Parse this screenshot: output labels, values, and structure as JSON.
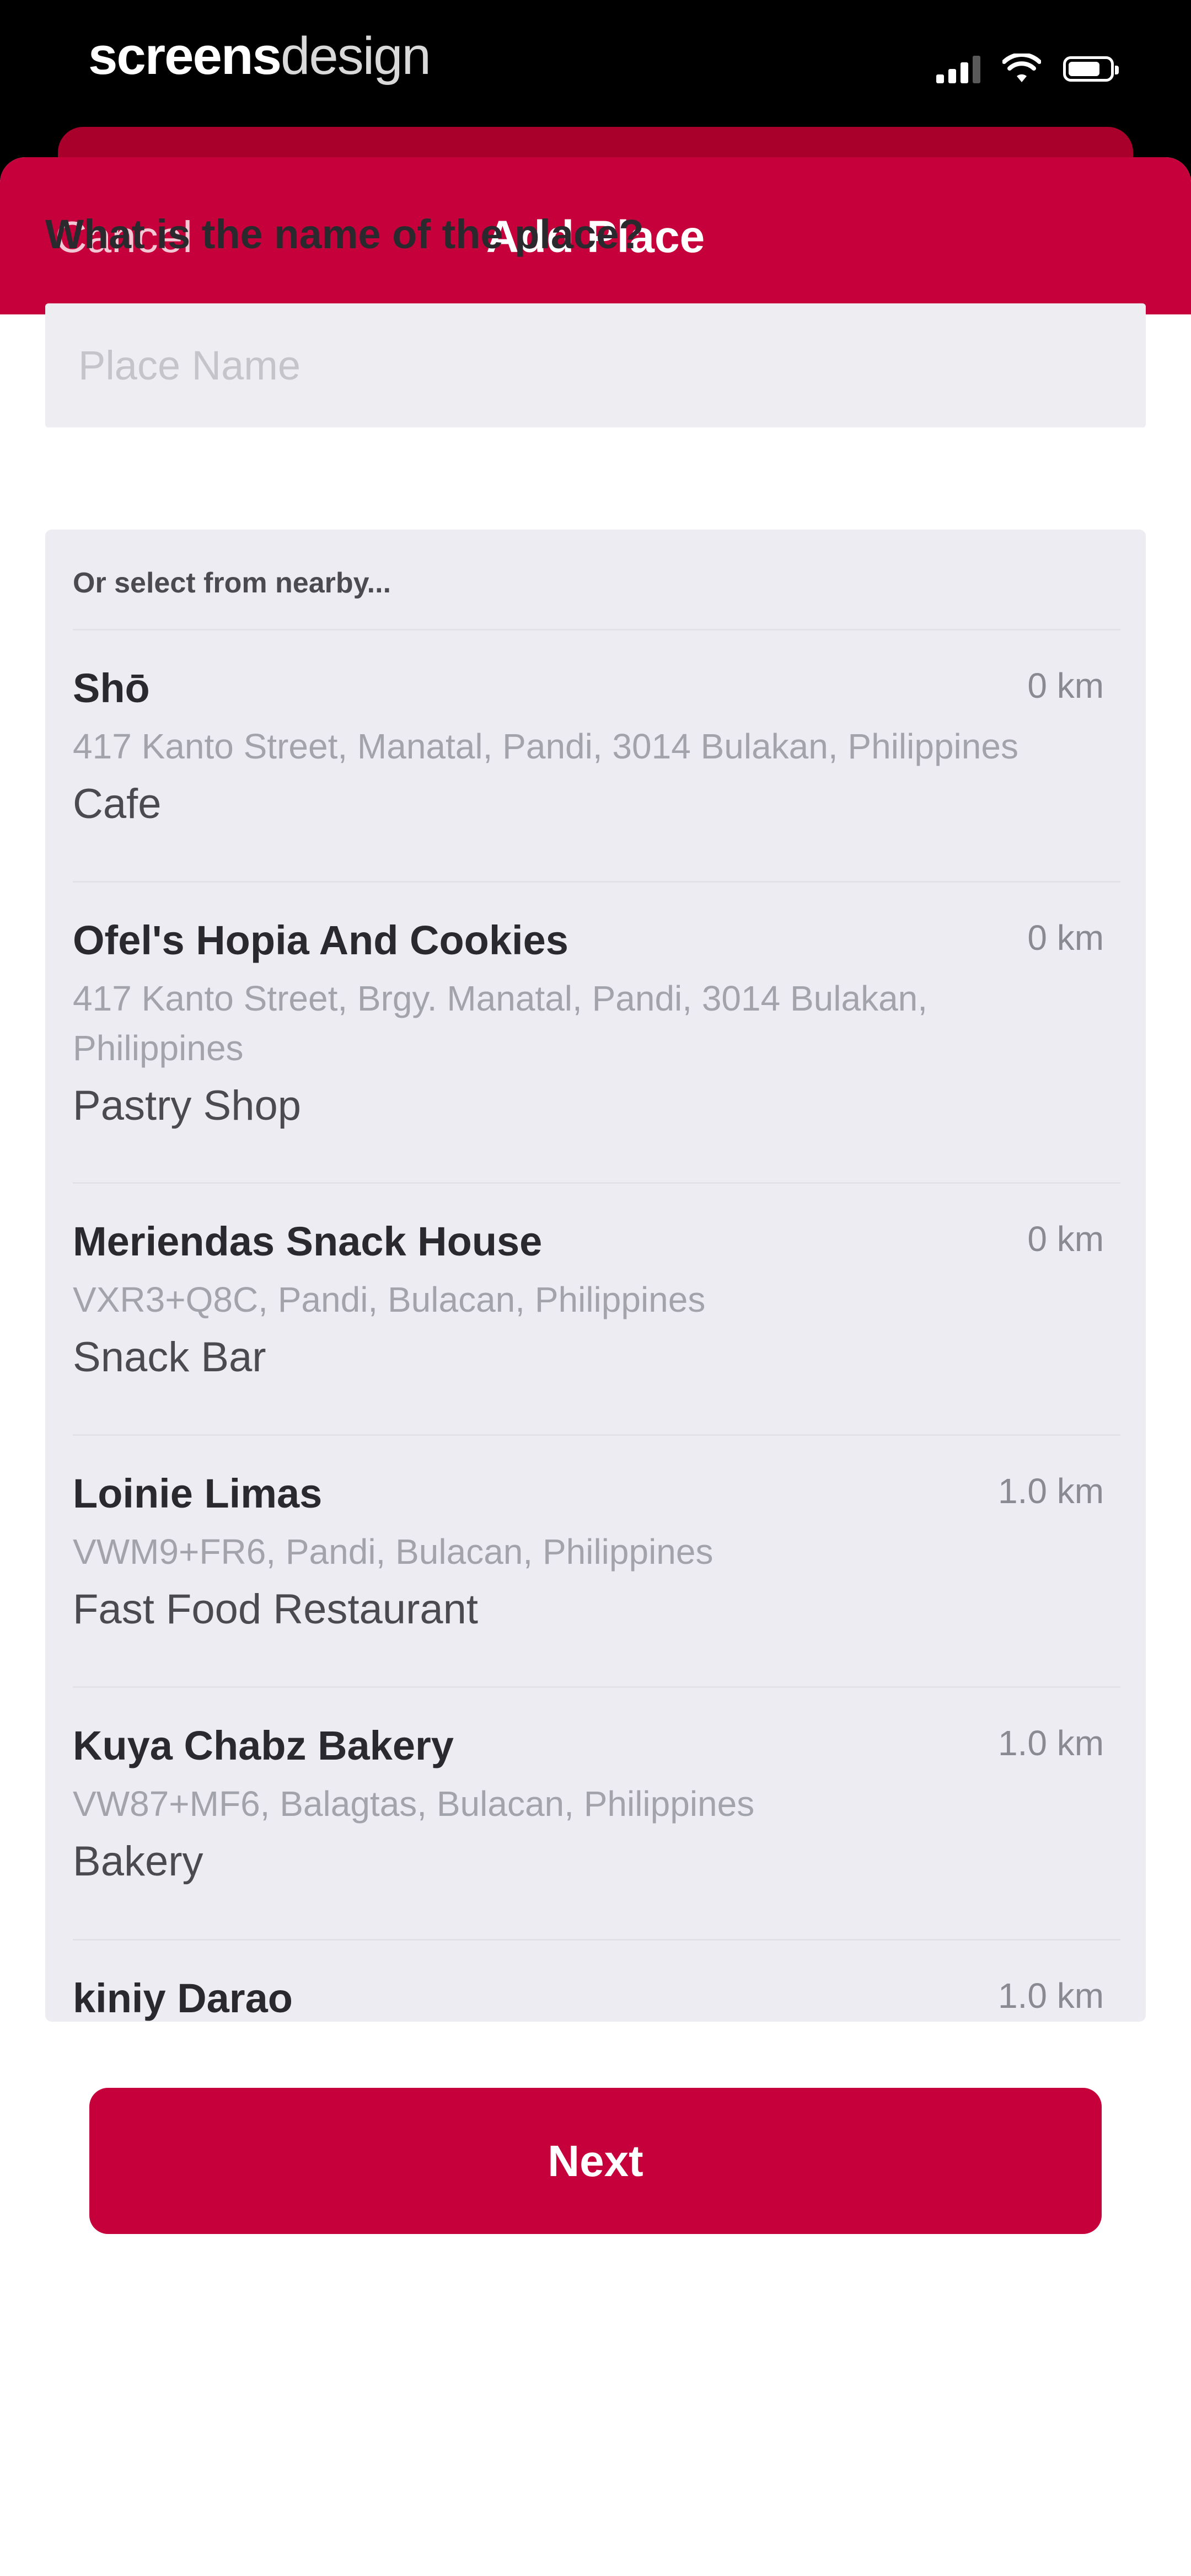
{
  "status_bar": {
    "brand_bold": "screens",
    "brand_light": "design",
    "icons": [
      "cellular-signal-icon",
      "wifi-icon",
      "battery-icon"
    ]
  },
  "nav": {
    "cancel_label": "Cancel",
    "title": "Add Place"
  },
  "form": {
    "question": "What is the name of the place?",
    "place_name_placeholder": "Place Name",
    "place_name_value": ""
  },
  "nearby": {
    "heading": "Or select from nearby...",
    "places": [
      {
        "name": "Shō",
        "distance": "0 km",
        "address": "417 Kanto Street, Manatal, Pandi, 3014 Bulakan, Philippines",
        "category": "Cafe"
      },
      {
        "name": "Ofel's Hopia And Cookies",
        "distance": "0 km",
        "address": "417 Kanto Street, Brgy. Manatal, Pandi, 3014 Bulakan, Philippines",
        "category": "Pastry Shop"
      },
      {
        "name": "Meriendas Snack House",
        "distance": "0 km",
        "address": "VXR3+Q8C, Pandi, Bulacan, Philippines",
        "category": "Snack Bar"
      },
      {
        "name": "Loinie Limas",
        "distance": "1.0 km",
        "address": "VWM9+FR6, Pandi, Bulacan, Philippines",
        "category": "Fast Food Restaurant"
      },
      {
        "name": "Kuya Chabz Bakery",
        "distance": "1.0 km",
        "address": "VW87+MF6, Balagtas, Bulacan, Philippines",
        "category": "Bakery"
      },
      {
        "name": "kiniy Darao",
        "distance": "1.0 km",
        "address": "",
        "category": ""
      }
    ]
  },
  "actions": {
    "next_label": "Next"
  },
  "colors": {
    "accent": "#c6003a",
    "panel": "#ececf2",
    "input_bg": "#ededf2"
  }
}
